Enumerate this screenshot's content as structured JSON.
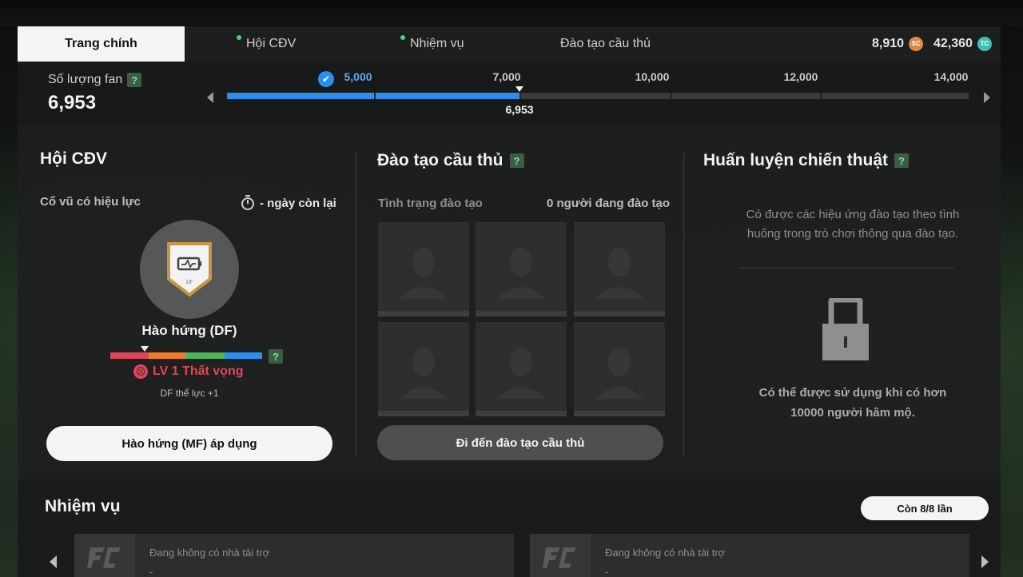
{
  "tabs": [
    {
      "label": "Trang chính",
      "active": true
    },
    {
      "label": "Hội CĐV",
      "dot": true
    },
    {
      "label": "Nhiệm vụ",
      "dot": true
    },
    {
      "label": "Đào tạo cầu thủ"
    }
  ],
  "currency": {
    "sc": "8,910",
    "sc_icon": "SC",
    "tc": "42,360",
    "tc_icon": "TC"
  },
  "fans": {
    "label": "Số lượng fan",
    "value": "6,953",
    "milestones": [
      "5,000",
      "7,000",
      "10,000",
      "12,000",
      "14,000"
    ],
    "current_marker": "6,953",
    "progress_fraction": 0.395
  },
  "fan_club": {
    "title": "Hội CĐV",
    "cheer_label": "Cổ vũ có hiệu lực",
    "days_left": "- ngày còn lại",
    "badge_text": "DF",
    "mood_name": "Hào hứng (DF)",
    "mood_level": "LV 1 Thất vọng",
    "mood_effect": "DF thể lực +1",
    "apply_button": "Hào hứng (MF) áp dụng"
  },
  "training": {
    "title": "Đào tạo cầu thủ",
    "status_label": "Tình trạng đào tạo",
    "count_label": "0 người đang đào tạo",
    "goto_button": "Đi đến đào tạo cầu thủ"
  },
  "tactics": {
    "title": "Huấn luyện chiến thuật",
    "description": "Có được các hiệu ứng đào tạo theo tình huống trong trò chơi thông qua đào tạo.",
    "locked_text": "Có thể được sử dụng khi có hơn 10000 người hâm mộ."
  },
  "missions": {
    "title": "Nhiệm vụ",
    "remaining": "Còn 8/8 lần",
    "cards": [
      {
        "text": "Đang không có nhà tài trợ",
        "sub": "-"
      },
      {
        "text": "Đang không có nhà tài trợ",
        "sub": "-"
      }
    ]
  },
  "colors": {
    "accent_blue": "#2a8ff0",
    "mood_red": "#e14658",
    "help_green": "#3b5e43"
  }
}
